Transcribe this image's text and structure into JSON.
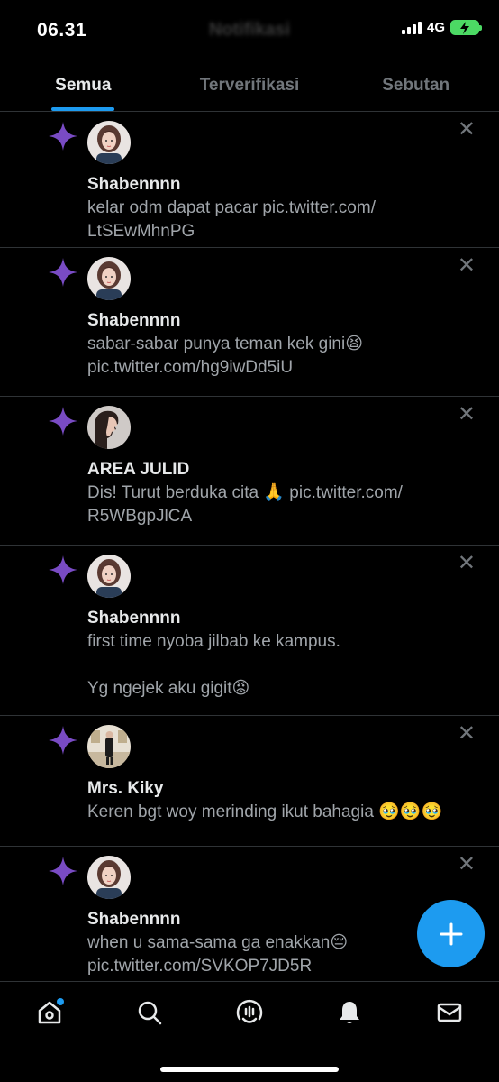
{
  "status_bar": {
    "time": "06.31",
    "network": "4G"
  },
  "header": {
    "title": "Notifikasi"
  },
  "tabs": [
    {
      "label": "Semua",
      "active": true
    },
    {
      "label": "Terverifikasi",
      "active": false
    },
    {
      "label": "Sebutan",
      "active": false
    }
  ],
  "notifications": [
    {
      "name": "Shabennnn",
      "text": "kelar odm dapat pacar pic.twitter.com/\nLtSEwMhnPG",
      "avatar": "avatar-woman"
    },
    {
      "name": "Shabennnn",
      "text": "sabar-sabar punya teman kek gini😫\npic.twitter.com/hg9iwDd5iU",
      "avatar": "avatar-woman"
    },
    {
      "name": "AREA JULID",
      "text": "Dis! Turut berduka cita 🙏 pic.twitter.com/\nR5WBgpJlCA",
      "avatar": "avatar-profile"
    },
    {
      "name": "Shabennnn",
      "text": "first time nyoba jilbab ke kampus.\n\nYg ngejek aku gigit😡",
      "avatar": "avatar-woman"
    },
    {
      "name": "Mrs. Kiky",
      "text": "Keren bgt woy merinding ikut bahagia 🥹🥹🥹",
      "avatar": "avatar-room"
    },
    {
      "name": "Shabennnn",
      "text": "when u sama-sama ga enakkan😔\npic.twitter.com/SVKOP7JD5R",
      "avatar": "avatar-woman"
    }
  ],
  "icons": {
    "sparkle": "sparkle-icon",
    "close": "close-icon",
    "compose": "plus-icon",
    "nav": [
      "home-icon",
      "search-icon",
      "spaces-icon",
      "bell-icon",
      "mail-icon"
    ]
  },
  "colors": {
    "accent": "#1d9bf0",
    "sparkle": "#794bc4",
    "background": "#000000"
  }
}
